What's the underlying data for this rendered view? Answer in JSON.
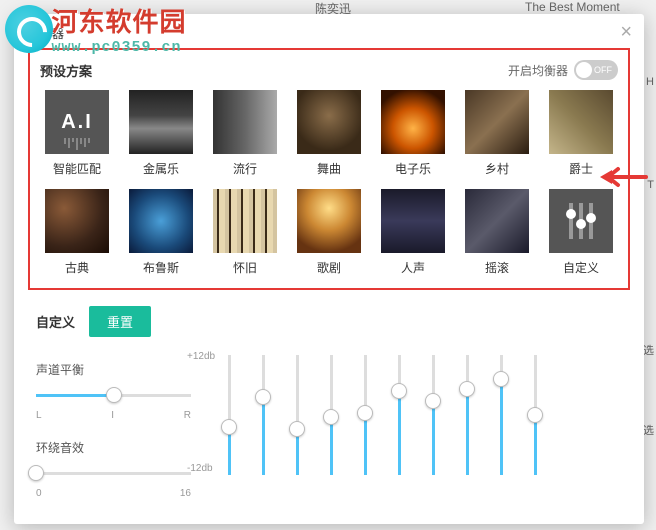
{
  "watermark": {
    "title": "河东软件园",
    "url": "www.pc0359.cn"
  },
  "background": {
    "artist": "陈奕迅",
    "album": "The Best Moment"
  },
  "panel": {
    "header": "均衡器",
    "preset_title": "预设方案",
    "eq_toggle_label": "开启均衡器",
    "eq_toggle_state": "OFF",
    "presets": [
      {
        "label": "智能匹配",
        "thumb": "ai"
      },
      {
        "label": "金属乐",
        "thumb": "metal"
      },
      {
        "label": "流行",
        "thumb": "pop"
      },
      {
        "label": "舞曲",
        "thumb": "dance"
      },
      {
        "label": "电子乐",
        "thumb": "elec"
      },
      {
        "label": "乡村",
        "thumb": "country"
      },
      {
        "label": "爵士",
        "thumb": "jazz"
      },
      {
        "label": "古典",
        "thumb": "classic"
      },
      {
        "label": "布鲁斯",
        "thumb": "blues"
      },
      {
        "label": "怀旧",
        "thumb": "oldie"
      },
      {
        "label": "歌剧",
        "thumb": "opera"
      },
      {
        "label": "人声",
        "thumb": "vocal"
      },
      {
        "label": "摇滚",
        "thumb": "rock"
      },
      {
        "label": "自定义",
        "thumb": "custom"
      }
    ],
    "custom_title": "自定义",
    "reset_label": "重置",
    "balance": {
      "label": "声道平衡",
      "left": "L",
      "mid": "I",
      "right": "R",
      "value_pct": 50
    },
    "surround": {
      "label": "环绕音效",
      "min": "0",
      "max": "16",
      "value_pct": 0
    },
    "eq": {
      "db_top": "+12db",
      "db_bot": "-12db",
      "bands_pct": [
        40,
        65,
        38,
        48,
        52,
        70,
        62,
        72,
        80,
        50
      ]
    }
  },
  "side_labels": [
    "H",
    "e T",
    "选",
    "选"
  ]
}
